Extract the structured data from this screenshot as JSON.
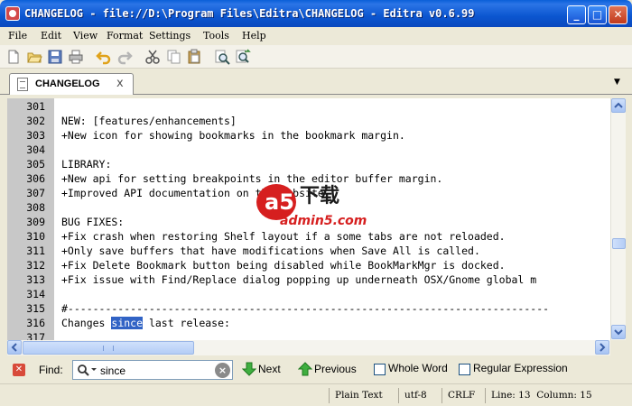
{
  "window": {
    "title": "CHANGELOG - file://D:\\Program Files\\Editra\\CHANGELOG - Editra v0.6.99",
    "controls": {
      "minimize": "_",
      "maximize": "□",
      "close": "✕"
    }
  },
  "menu": [
    "File",
    "Edit",
    "View",
    "Format",
    "Settings",
    "Tools",
    "Help"
  ],
  "toolbar": {
    "icons": [
      "new-file-icon",
      "open-folder-icon",
      "save-icon",
      "print-icon",
      "undo-icon",
      "redo-icon",
      "cut-icon",
      "copy-icon",
      "paste-icon",
      "find-icon",
      "find-replace-icon"
    ]
  },
  "tabs": [
    {
      "label": "CHANGELOG",
      "close": "x"
    }
  ],
  "tab_menu_arrow": "▼",
  "editor": {
    "lines": [
      {
        "num": "301",
        "text": ""
      },
      {
        "num": "302",
        "text": "NEW: [features/enhancements]"
      },
      {
        "num": "303",
        "text": "+New icon for showing bookmarks in the bookmark margin."
      },
      {
        "num": "304",
        "text": ""
      },
      {
        "num": "305",
        "text": "LIBRARY:"
      },
      {
        "num": "306",
        "text": "+New api for setting breakpoints in the editor buffer margin."
      },
      {
        "num": "307",
        "text": "+Improved API documentation on the website."
      },
      {
        "num": "308",
        "text": ""
      },
      {
        "num": "309",
        "text": "BUG FIXES:"
      },
      {
        "num": "310",
        "text": "+Fix crash when restoring Shelf layout if a some tabs are not reloaded."
      },
      {
        "num": "311",
        "text": "+Only save buffers that have modifications when Save All is called."
      },
      {
        "num": "312",
        "text": "+Fix Delete Bookmark button being disabled while BookMarkMgr is docked."
      },
      {
        "num": "313",
        "text": "+Fix issue with Find/Replace dialog popping up underneath OSX/Gnome global m"
      },
      {
        "num": "314",
        "text": ""
      },
      {
        "num": "315",
        "text": "#-----------------------------------------------------------------------------"
      },
      {
        "num": "316",
        "pre": "Changes ",
        "match": "since",
        "post": " last release:"
      },
      {
        "num": "317",
        "text": ""
      }
    ]
  },
  "find_bar": {
    "close": "✕",
    "label": "Find:",
    "query": "since",
    "clear": "×",
    "next": "Next",
    "previous": "Previous",
    "whole_word": "Whole Word",
    "regex": "Regular Expression"
  },
  "status": {
    "filetype": "Plain Text",
    "encoding": "utf-8",
    "eol": "CRLF",
    "position": "Line: 13  Column: 15"
  },
  "watermark": {
    "brand": "a5",
    "cn": "下载",
    "site": "admin5.com"
  }
}
